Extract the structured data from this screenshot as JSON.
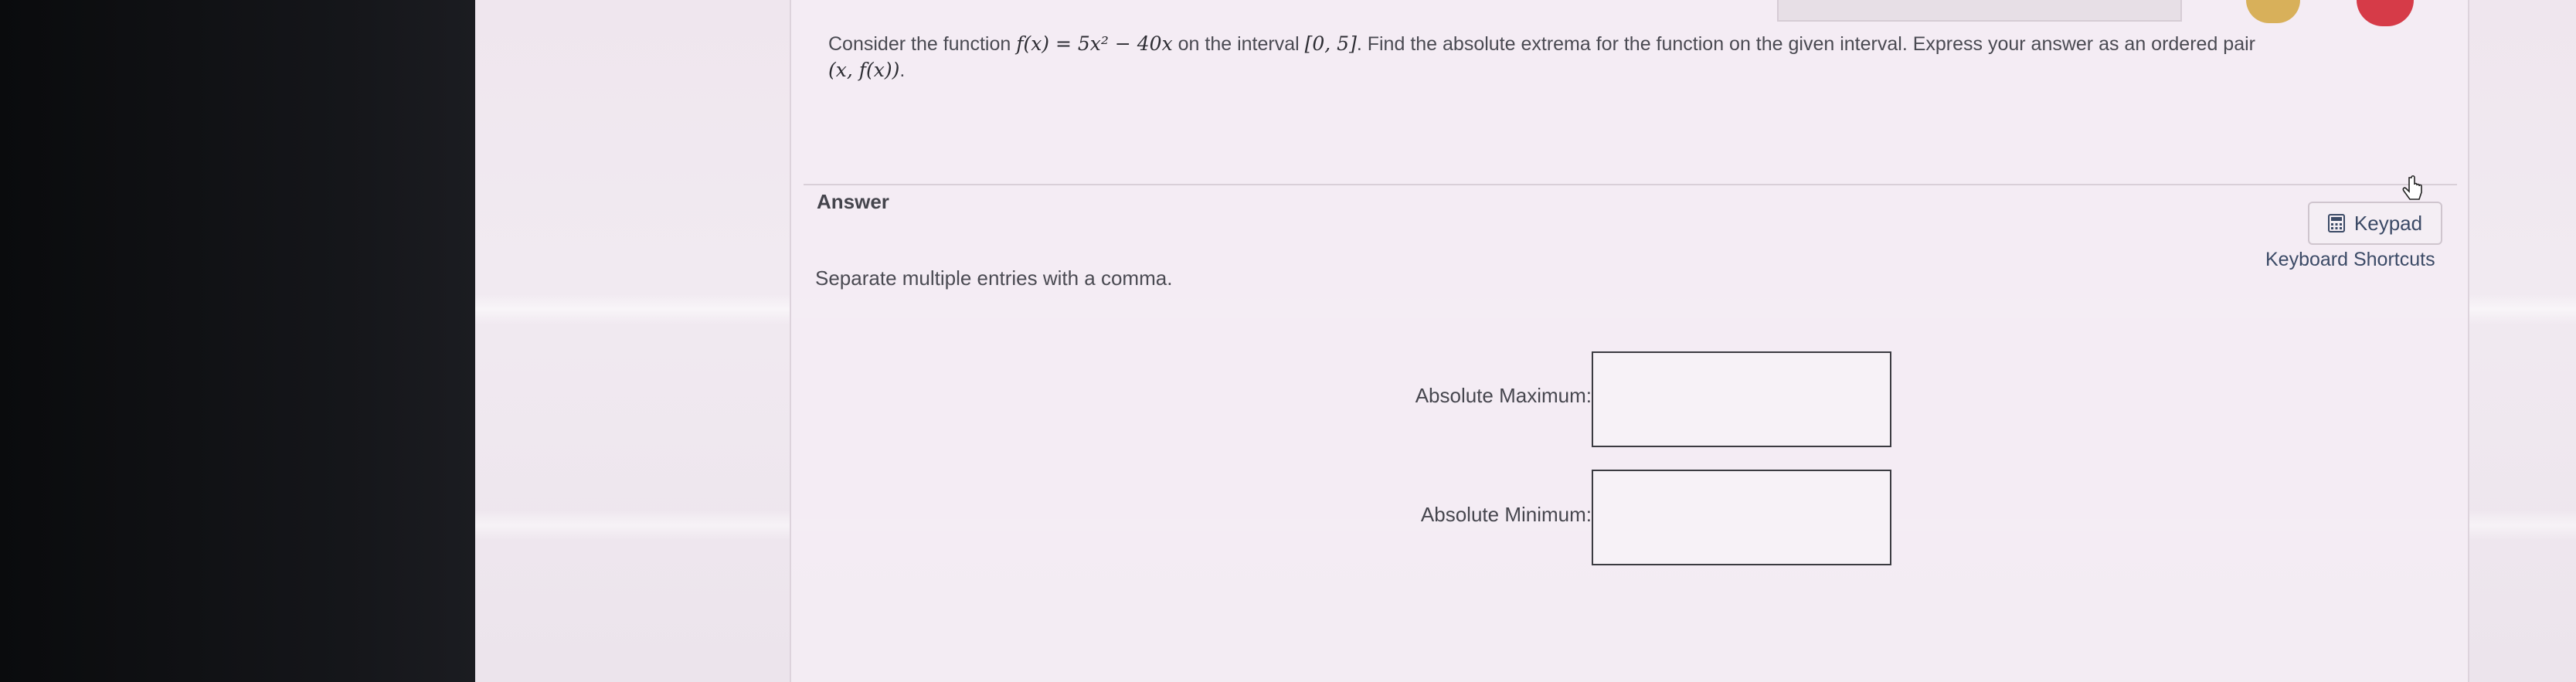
{
  "question": {
    "prefix": "Consider the function ",
    "function": "f(x) = 5x² − 40x",
    "middle": " on the interval ",
    "interval": "[0, 5]",
    "suffix": ". Find the absolute extrema for the function on the given interval. Express your answer as an ordered pair",
    "ordered_pair": "(x, f(x))",
    "period": "."
  },
  "answer": {
    "label": "Answer",
    "instruction": "Separate multiple entries with a comma."
  },
  "tools": {
    "keypad_label": "Keypad",
    "keypad_icon": "calculator-icon",
    "shortcuts_label": "Keyboard Shortcuts"
  },
  "fields": {
    "max_label": "Absolute Maximum:",
    "max_value": "",
    "min_label": "Absolute Minimum:",
    "min_value": ""
  },
  "colors": {
    "link": "#3b4a66",
    "badge_gold": "#d8b05a",
    "badge_red": "#d63b48"
  }
}
